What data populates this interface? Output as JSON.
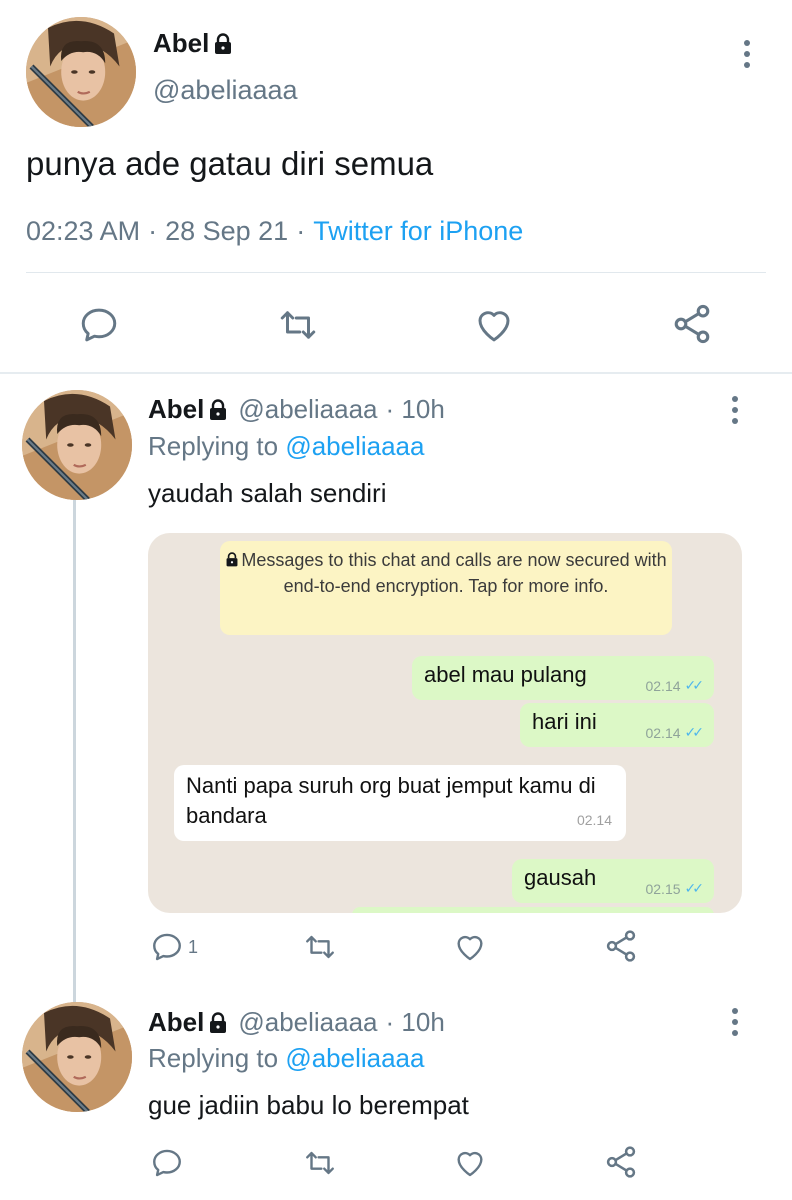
{
  "main_tweet": {
    "name": "Abel",
    "handle": "@abeliaaaa",
    "text": "punya ade gatau diri semua",
    "time": "02:23 AM",
    "date": "28 Sep 21",
    "separator": "·",
    "source": "Twitter for iPhone"
  },
  "replies": [
    {
      "name": "Abel",
      "handle": "@abeliaaaa",
      "age": "· 10h",
      "replying_label": "Replying to",
      "replying_to": "@abeliaaaa",
      "text": "yaudah salah sendiri",
      "reply_count": "1"
    },
    {
      "name": "Abel",
      "handle": "@abeliaaaa",
      "age": "· 10h",
      "replying_label": "Replying to",
      "replying_to": "@abeliaaaa",
      "text": "gue jadiin babu lo berempat"
    }
  ],
  "chat": {
    "encryption_notice": "Messages to this chat and calls are now secured with end-to-end encryption. Tap for more info.",
    "messages": [
      {
        "text": "abel mau pulang",
        "time": "02.14",
        "direction": "out"
      },
      {
        "text": "hari ini",
        "time": "02.14",
        "direction": "out"
      },
      {
        "text": "Nanti papa suruh org buat jemput kamu di bandara",
        "time": "02.14",
        "direction": "in"
      },
      {
        "text": "gausah",
        "time": "02.15",
        "direction": "out"
      }
    ]
  },
  "icons": {
    "reply": "reply-icon",
    "retweet": "retweet-icon",
    "like": "heart-icon",
    "share": "share-icon",
    "more": "more-vertical-icon",
    "lock": "lock-icon"
  },
  "colors": {
    "link": "#1da1f2",
    "secondary_text": "#657786",
    "chat_bg": "#ece5dd",
    "outgoing_bubble": "#dcf8c6",
    "encryption_banner": "#fcf4c4"
  }
}
